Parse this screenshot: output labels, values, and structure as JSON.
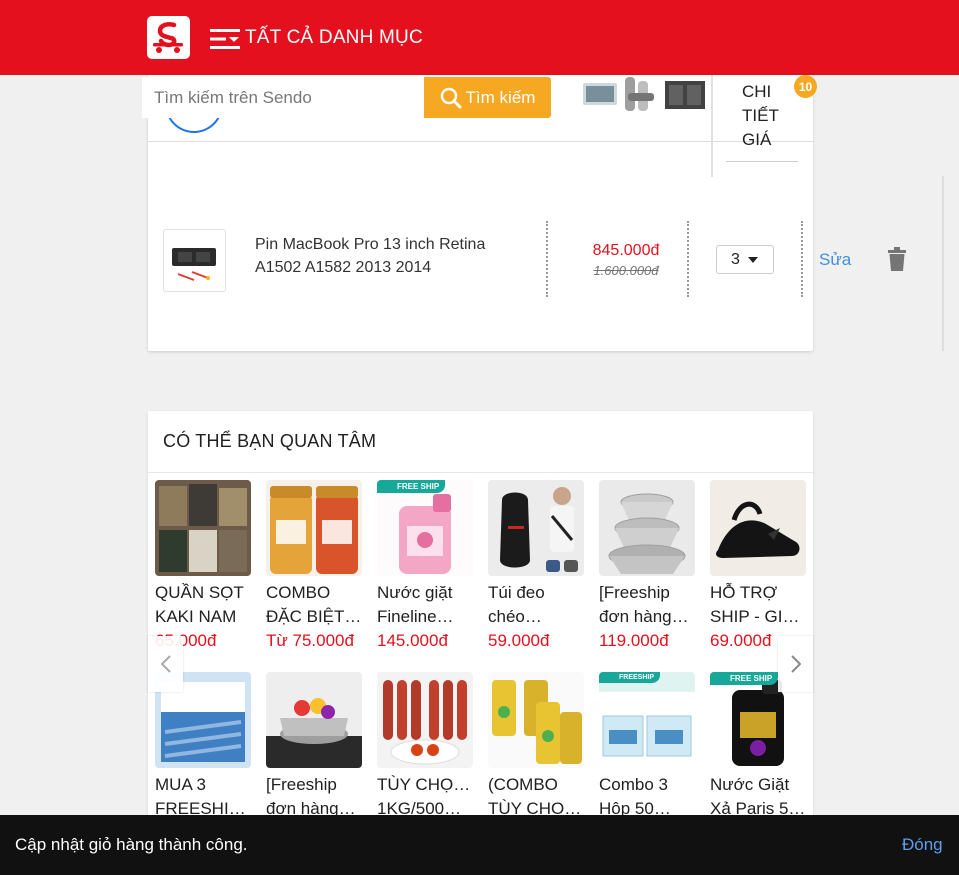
{
  "header": {
    "logo_icon": "sendo-logo-icon",
    "menu_icon": "menu-icon",
    "menu_label": "TẤT CẢ DANH MỤC",
    "brand_color": "#e5101d"
  },
  "search": {
    "placeholder": "Tìm kiếm trên Sendo",
    "button_label": "Tìm kiếm",
    "button_color": "#f7a823"
  },
  "cart": {
    "detail_label_1": "CHI",
    "detail_label_2": "TIẾT",
    "detail_label_3": "GIÁ",
    "badge_count": "10",
    "item": {
      "name_line1": "Pin MacBook Pro 13 inch Retina",
      "name_line2": "A1502 A1582 2013 2014",
      "price": "845.000đ",
      "old_price": "1.600.000đ",
      "quantity": "3",
      "edit_label": "Sửa"
    }
  },
  "recommend": {
    "title": "CÓ THỂ BẠN QUAN TÂM",
    "free_ship_label": "FREE SHIP",
    "row1": [
      {
        "line1": "QUẦN SỌT",
        "line2": "KAKI NAM",
        "price": "65.000đ"
      },
      {
        "line1": "COMBO",
        "line2": "ĐẶC BIỆT…",
        "price": "Từ 75.000đ"
      },
      {
        "line1": "Nước giặt",
        "line2": "Fineline…",
        "price": "145.000đ"
      },
      {
        "line1": "Túi đeo",
        "line2": "chéo…",
        "price": "59.000đ"
      },
      {
        "line1": "[Freeship",
        "line2": "đơn hàng…",
        "price": "119.000đ"
      },
      {
        "line1": "HỖ TRỢ",
        "line2": "SHIP - GIÀ…",
        "price": "69.000đ"
      }
    ],
    "row2": [
      {
        "line1": "MUA 3",
        "line2": "FREESHIP…"
      },
      {
        "line1": "[Freeship",
        "line2": "đơn hàng…"
      },
      {
        "line1": "TÙY CHỌN :",
        "line2": "1KG/500G…"
      },
      {
        "line1": "(COMBO",
        "line2": "TÙY CHỌ…"
      },
      {
        "line1": "Combo 3",
        "line2": "Hộp 50…"
      },
      {
        "line1": "Nước Giặt",
        "line2": "Xả Paris 5…"
      }
    ]
  },
  "snackbar": {
    "message": "Cập nhật giỏ hàng thành công.",
    "close_label": "Đóng"
  }
}
